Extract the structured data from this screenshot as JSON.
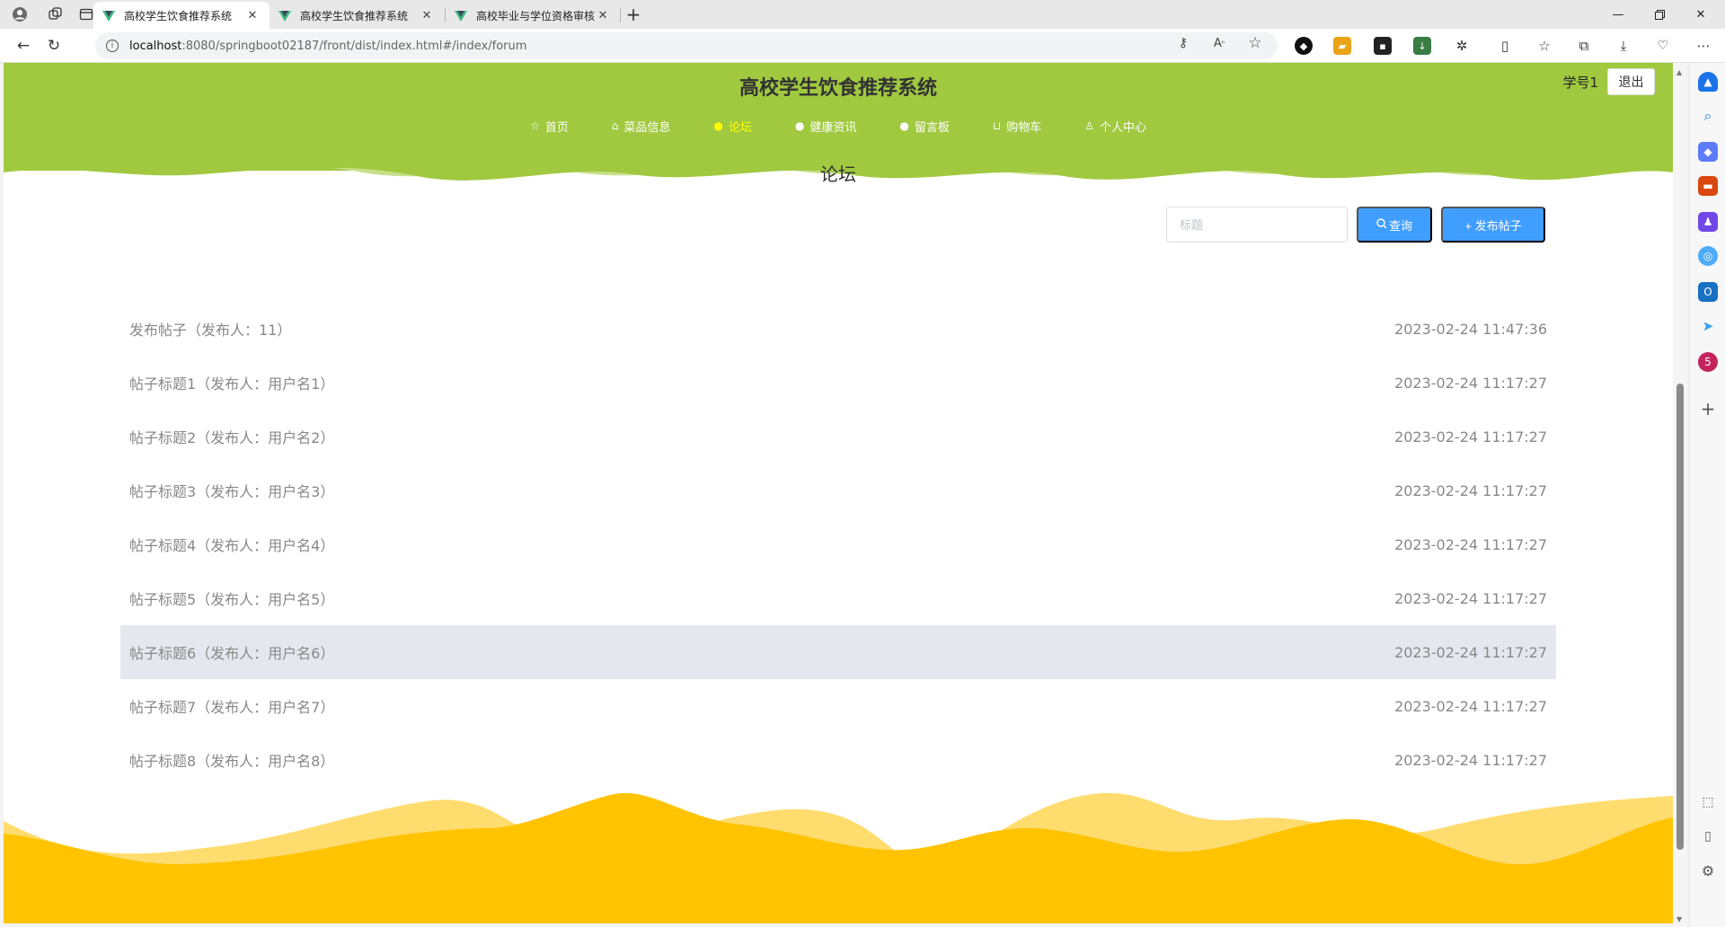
{
  "browser": {
    "tabs": [
      {
        "title": "高校学生饮食推荐系统",
        "active": true
      },
      {
        "title": "高校学生饮食推荐系统",
        "active": false
      },
      {
        "title": "高校毕业与学位资格审核系统",
        "active": false
      }
    ],
    "url_host": "localhost",
    "url_path": ":8080/springboot02187/front/dist/index.html#/index/forum"
  },
  "header": {
    "title": "高校学生饮食推荐系统",
    "username": "学号1",
    "logout": "退出"
  },
  "nav": [
    {
      "label": "首页",
      "icon": "star-icon",
      "glyph": "☆"
    },
    {
      "label": "菜品信息",
      "icon": "bag-icon",
      "glyph": "⌂"
    },
    {
      "label": "论坛",
      "icon": "info-circle-icon",
      "glyph": "●",
      "active": true
    },
    {
      "label": "健康资讯",
      "icon": "question-circle-icon",
      "glyph": "●"
    },
    {
      "label": "留言板",
      "icon": "info-circle-icon",
      "glyph": "●"
    },
    {
      "label": "购物车",
      "icon": "cart-icon",
      "glyph": "⊔"
    },
    {
      "label": "个人中心",
      "icon": "user-icon",
      "glyph": "♙"
    }
  ],
  "page": {
    "heading": "论坛",
    "search_placeholder": "标题",
    "search_button": "查询",
    "publish_button": "+ 发布帖子"
  },
  "posts": [
    {
      "title": "发布帖子（发布人：11）",
      "time": "2023-02-24 11:47:36"
    },
    {
      "title": "帖子标题1（发布人：用户名1）",
      "time": "2023-02-24 11:17:27"
    },
    {
      "title": "帖子标题2（发布人：用户名2）",
      "time": "2023-02-24 11:17:27"
    },
    {
      "title": "帖子标题3（发布人：用户名3）",
      "time": "2023-02-24 11:17:27"
    },
    {
      "title": "帖子标题4（发布人：用户名4）",
      "time": "2023-02-24 11:17:27"
    },
    {
      "title": "帖子标题5（发布人：用户名5）",
      "time": "2023-02-24 11:17:27"
    },
    {
      "title": "帖子标题6（发布人：用户名6）",
      "time": "2023-02-24 11:17:27",
      "hover": true
    },
    {
      "title": "帖子标题7（发布人：用户名7）",
      "time": "2023-02-24 11:17:27"
    },
    {
      "title": "帖子标题8（发布人：用户名8）",
      "time": "2023-02-24 11:17:27"
    }
  ],
  "colors": {
    "header_green": "#a0c940",
    "footer_yellow": "#ffc300",
    "footer_yellow_light": "#ffdc6e",
    "button_blue": "#409eff",
    "active_nav": "#ffff00",
    "hover_row": "#e4e8ee"
  }
}
